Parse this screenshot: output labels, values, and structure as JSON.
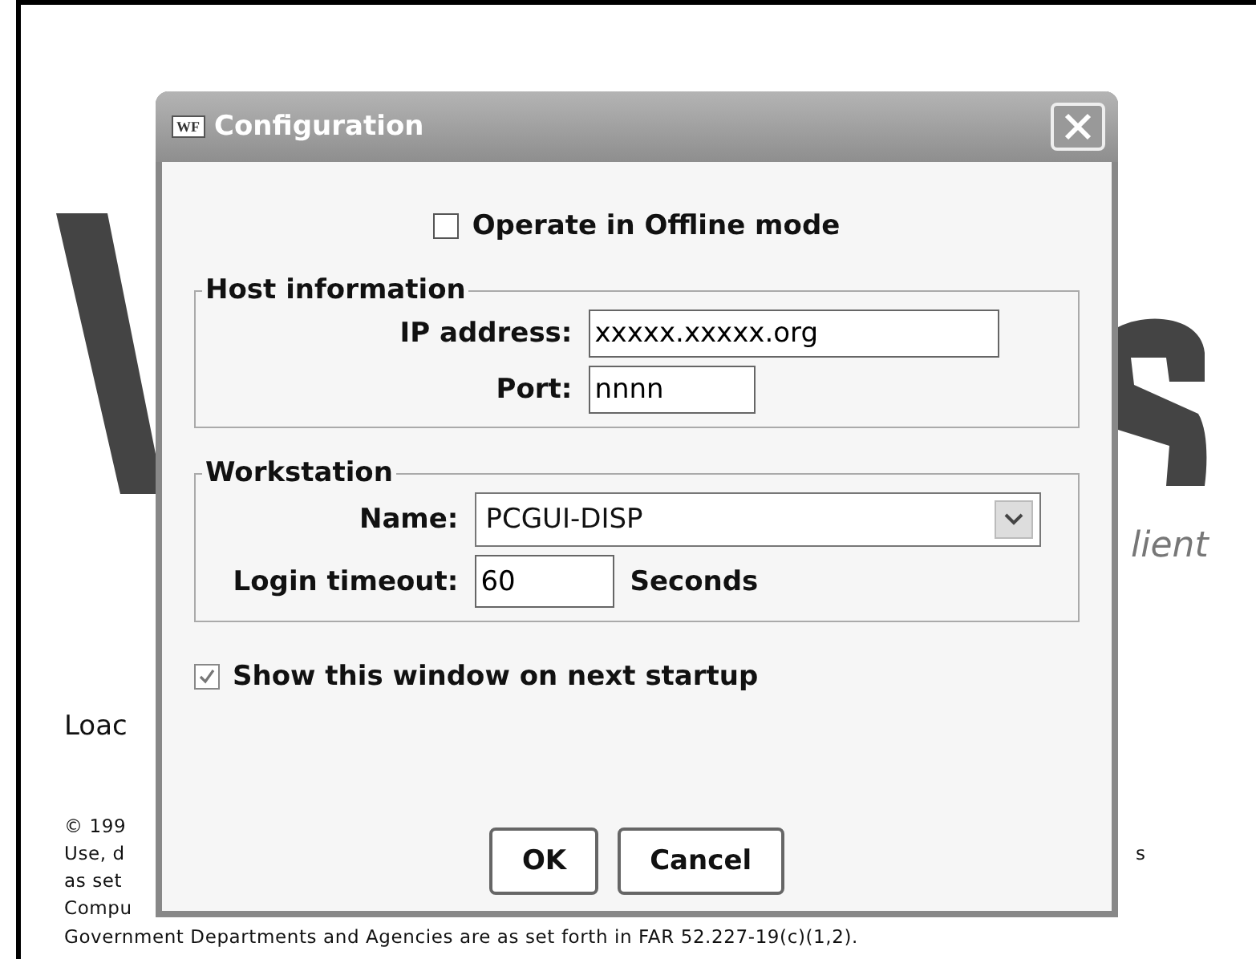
{
  "splash": {
    "tagline": "lient",
    "loading": "Loac",
    "legal_lines": [
      "© 199",
      "Use, d",
      "as set",
      "Compu"
    ],
    "legal_right": "s",
    "legal_footer": "Government Departments and Agencies are as set forth in FAR 52.227-19(c)(1,2)."
  },
  "window": {
    "title": "Configuration",
    "icon_text": "WF"
  },
  "offline": {
    "label": "Operate in Offline mode",
    "checked": false
  },
  "host": {
    "title": "Host information",
    "ip_label": "IP address:",
    "ip_value": "xxxxx.xxxxx.org",
    "port_label": "Port:",
    "port_value": "nnnn"
  },
  "workstation": {
    "title": "Workstation",
    "name_label": "Name:",
    "name_value": "PCGUI-DISP",
    "timeout_label": "Login timeout:",
    "timeout_value": "60",
    "timeout_unit": "Seconds"
  },
  "startup": {
    "label": "Show this window on next startup",
    "checked": true
  },
  "buttons": [
    "OK",
    "Cancel"
  ]
}
